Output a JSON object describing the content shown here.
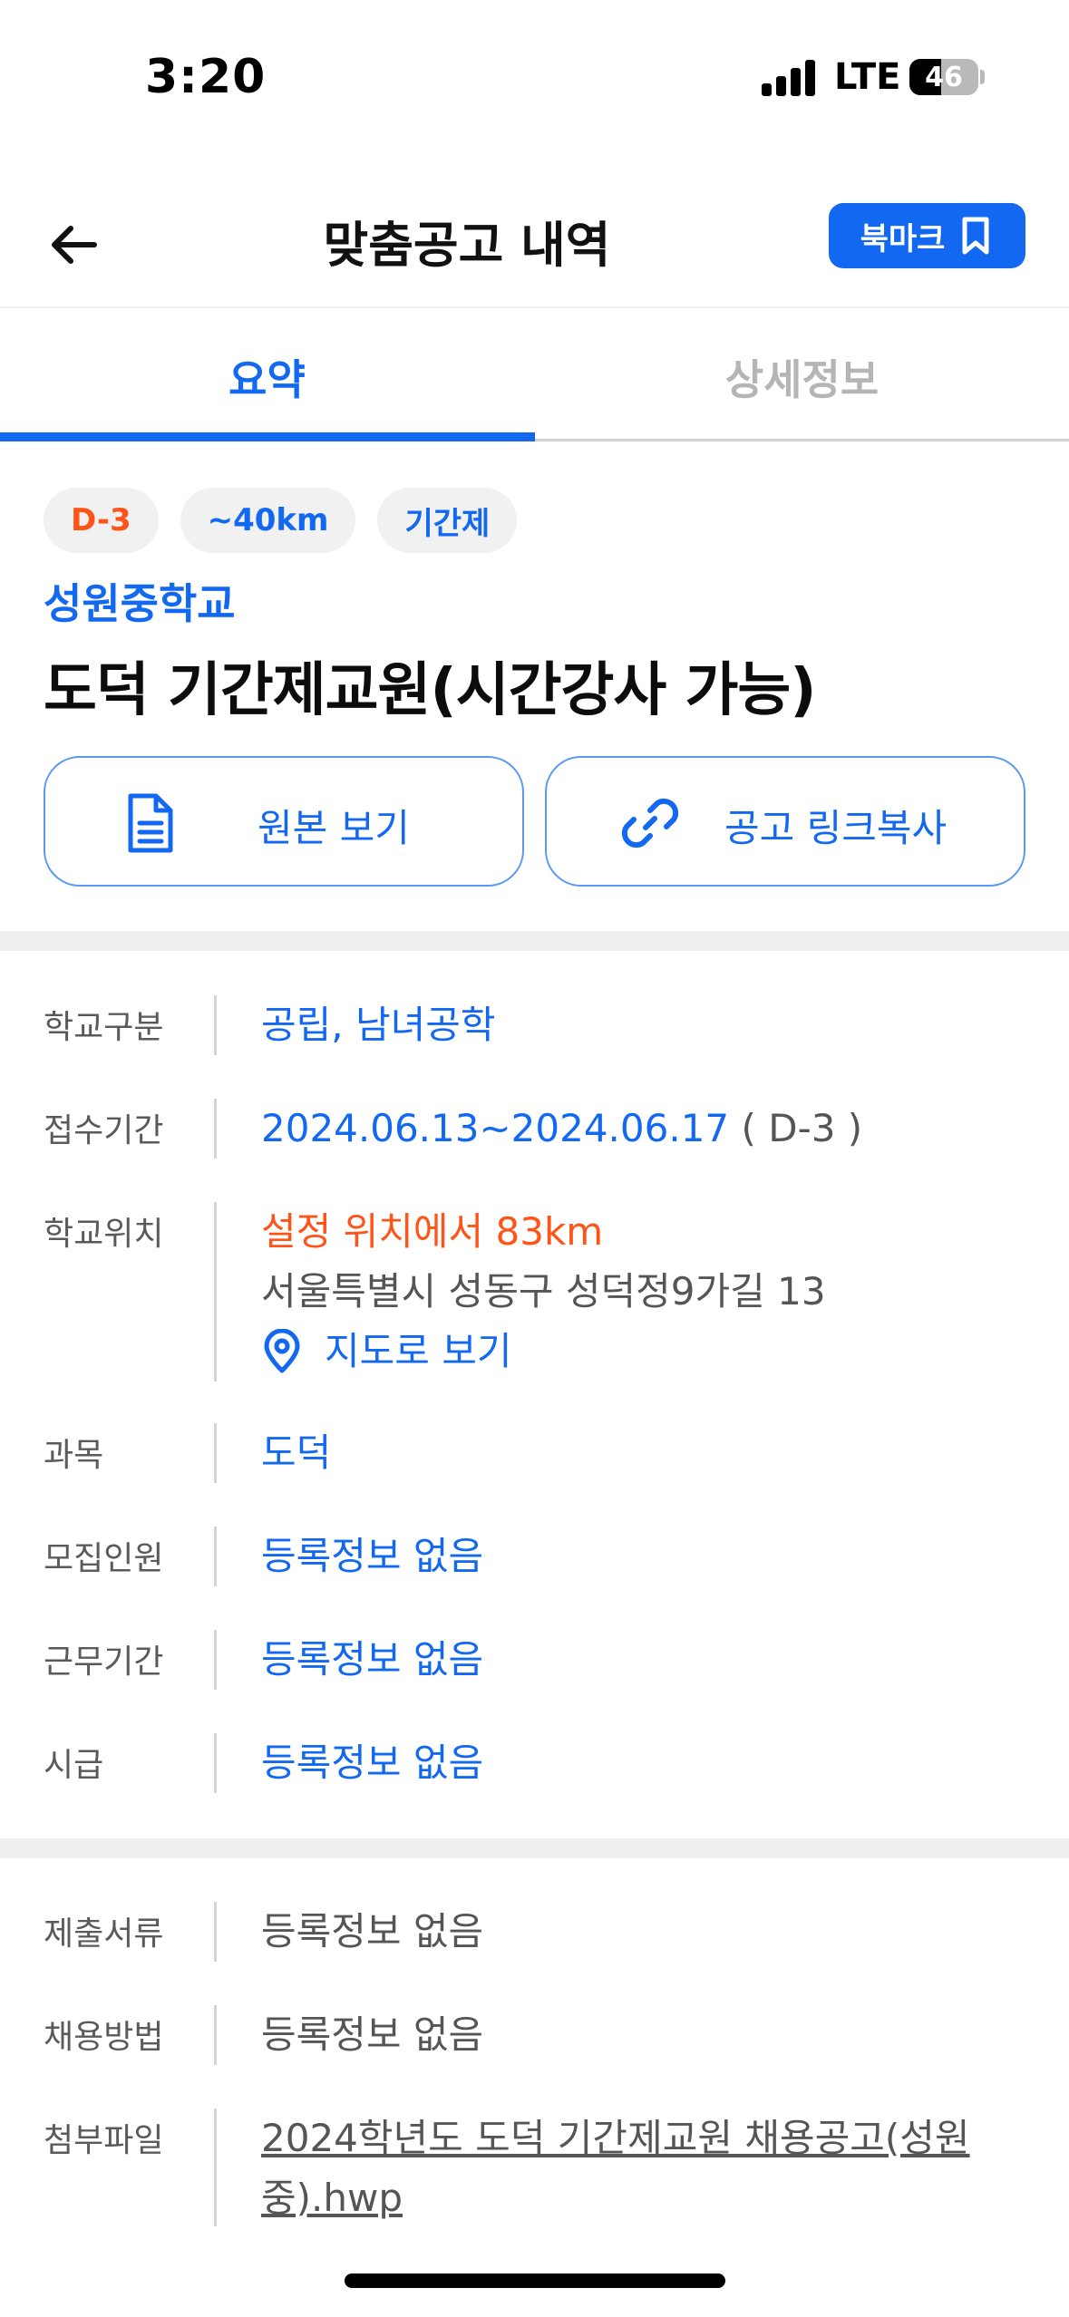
{
  "status_bar": {
    "time": "3:20",
    "network": "LTE",
    "battery": "46",
    "battery_level": 0.46
  },
  "nav": {
    "title": "맞춤공고 내역",
    "bookmark_label": "북마크"
  },
  "tabs": [
    {
      "label": "요약",
      "active": true
    },
    {
      "label": "상세정보",
      "active": false
    }
  ],
  "chips": [
    {
      "label": "D-3",
      "color": "#ff5418"
    },
    {
      "label": "~40km",
      "color": "#1268f0"
    },
    {
      "label": "기간제",
      "color": "#1268f0"
    }
  ],
  "school": "성원중학교",
  "job_title": "도덕 기간제교원(시간강사 가능)",
  "actions": {
    "view_original": "원본 보기",
    "copy_link": "공고 링크복사"
  },
  "info": {
    "school_type": {
      "label": "학교구분",
      "value": "공립, 남녀공학"
    },
    "period": {
      "label": "접수기간",
      "value": "2024.06.13~2024.06.17",
      "suffix": " ( D-3 )"
    },
    "location": {
      "label": "학교위치",
      "distance": "설정 위치에서 83km",
      "address": "서울특별시 성동구 성덕정9가길 13",
      "map_link": "지도로 보기"
    },
    "subject": {
      "label": "과목",
      "value": "도덕"
    },
    "recruits": {
      "label": "모집인원",
      "value": "등록정보 없음"
    },
    "work_period": {
      "label": "근무기간",
      "value": "등록정보 없음"
    },
    "hourly_pay": {
      "label": "시급",
      "value": "등록정보 없음"
    },
    "documents": {
      "label": "제출서류",
      "value": "등록정보 없음"
    },
    "method": {
      "label": "채용방법",
      "value": "등록정보 없음"
    },
    "attachment": {
      "label": "첨부파일",
      "value": "2024학년도 도덕 기간제교원 채용공고(성원중).hwp"
    }
  },
  "colors": {
    "primary": "#1268f0",
    "accent": "#ff5418"
  }
}
